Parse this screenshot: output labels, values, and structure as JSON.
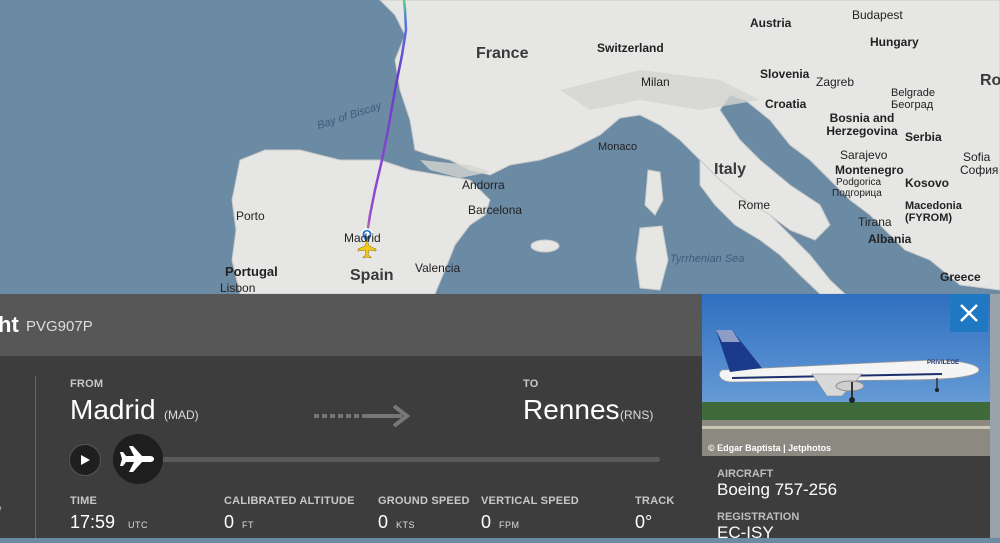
{
  "map": {
    "countries": [
      "France",
      "Switzerland",
      "Austria",
      "Hungary",
      "Slovenia",
      "Croatia",
      "Bosnia and Herzegovina",
      "Serbia",
      "Montenegro",
      "Kosovo",
      "Albania",
      "Italy",
      "Spain",
      "Portugal",
      "Andorra",
      "Greece",
      "Macedonia (FYROM)"
    ],
    "cities": [
      "Budapest",
      "Zagreb",
      "Milan",
      "Monaco",
      "Rome",
      "Barcelona",
      "Valencia",
      "Madrid",
      "Porto",
      "Lisbon",
      "Sarajevo",
      "Belgrade",
      "Београд",
      "Sofia",
      "София",
      "Tirana",
      "Podgorica",
      "Подгорица",
      "Ro"
    ],
    "seas": [
      "Bay of Biscay",
      "Tyrrhenian Sea"
    ],
    "colors": {
      "land": "#e8e8e6",
      "water": "#6b8aa3",
      "route_start": "#d7c12a",
      "route_end": "#6a3cc8"
    }
  },
  "header": {
    "title_fragment": "ht",
    "callsign": "PVG907P"
  },
  "route": {
    "from_label": "FROM",
    "from_city": "Madrid",
    "from_code": "(MAD)",
    "to_label": "TO",
    "to_city": "Rennes",
    "to_code": "(RNS)"
  },
  "playback": {
    "play_icon": "play-icon",
    "progress": 0.0
  },
  "stats": {
    "time_label": "TIME",
    "time_value": "17:59",
    "time_unit": "UTC",
    "alt_label": "CALIBRATED ALTITUDE",
    "alt_value": "0",
    "alt_unit": "FT",
    "gs_label": "GROUND SPEED",
    "gs_value": "0",
    "gs_unit": "KTS",
    "vs_label": "VERTICAL SPEED",
    "vs_value": "0",
    "vs_unit": "FPM",
    "track_label": "TRACK",
    "track_value": "0°"
  },
  "aircraft": {
    "photo_credit": "© Edgar Baptista | Jetphotos",
    "aircraft_label": "AIRCRAFT",
    "aircraft_value": "Boeing 757-256",
    "registration_label": "REGISTRATION",
    "registration_value": "EC-ISY"
  },
  "left_edge_glyph": "/"
}
